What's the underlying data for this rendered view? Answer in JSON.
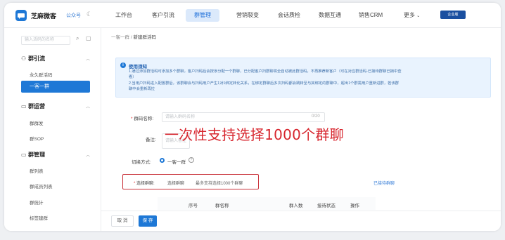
{
  "header": {
    "brand": "芝麻微客",
    "account": "公众号",
    "nav": [
      "工作台",
      "客户引流",
      "群管理",
      "营销裂变",
      "会话质检",
      "数据互通",
      "销售CRM",
      "更多"
    ],
    "active_nav": "群管理",
    "enterprise_badge": "企业版"
  },
  "sidebar": {
    "search_placeholder": "输入活码的名称",
    "sections": [
      {
        "label": "群引流",
        "items": [
          "永久群活码",
          "一客一群"
        ]
      },
      {
        "label": "群运营",
        "items": [
          "群群发",
          "群SOP"
        ]
      },
      {
        "label": "群管理",
        "items": [
          "群列表",
          "群成员列表",
          "群统计",
          "标签建群"
        ]
      }
    ],
    "active_item": "一客一群"
  },
  "breadcrumb": {
    "parent": "一客一群",
    "current": "新建群活码"
  },
  "notice": {
    "title": "使用须知",
    "line1": "1.通过添加群活码可添加多个群聊，客户扫码后会按序分配一个群聊，已分配客户扫群聊将全自动被此群活码，不再推荐新客户（可在对应群活码-已接待群聊已拥中查",
    "line2": "看）",
    "line3": "2.当用户扫码进入配置群后，该群聊会与扫码用户产生1对1绑定转化关系，在绑定群聊后多次扫码都会跳转至与其绑定的群聊中，超出1个群需用户重新进群，若该群",
    "line4": "聊中会重新再拉"
  },
  "form": {
    "name_label": "群码名称:",
    "name_placeholder": "请输入群码名称",
    "name_count": "0/20",
    "remark_label": "备注:",
    "remark_placeholder": "请输入备注",
    "mode_label": "切换方式:",
    "mode_value": "一客一群",
    "select_label": "选择群聊:",
    "select_button": "选择群聊",
    "select_hint": "最多支持选择1000个群聊",
    "selected_link": "已接待群聊"
  },
  "overlay_text": "一次性支持选择1000个群聊",
  "table": {
    "columns": [
      "序号",
      "群名称",
      "群人数",
      "接待状态",
      "操作"
    ]
  },
  "footer": {
    "cancel": "取 消",
    "save": "保 存"
  }
}
